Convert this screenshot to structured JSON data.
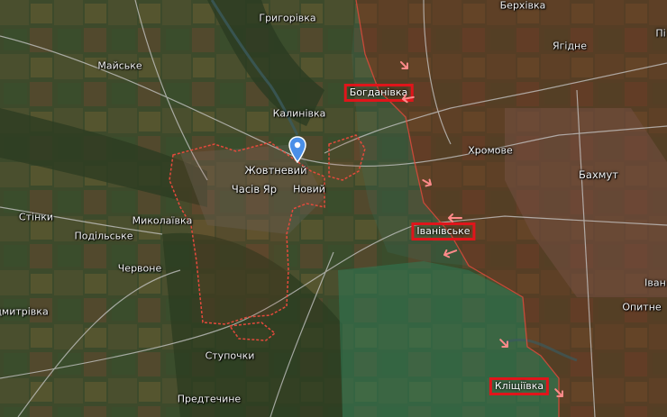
{
  "map": {
    "colors": {
      "occupied": "#7a2d1c",
      "liberated": "#2f7a55",
      "frontline": "#e54a3c",
      "highlight": "#e0151b",
      "pin": "#4a8fe8",
      "arrow": "#ff8a8a"
    },
    "labels": {
      "hryhorivka": "Григорівка",
      "berkhivka": "Берхівка",
      "maiske": "Майське",
      "yahidne": "Ягідне",
      "kalynivka": "Калинівка",
      "khromove": "Хромове",
      "zhovtnevyi": "Жовтневий",
      "bakhmut": "Бахмут",
      "chasiv_yar": "Часів Яр",
      "novyi": "Новий",
      "stinky": "Стінки",
      "mykolaivka": "Миколаївка",
      "podilske": "Подільське",
      "chervone": "Червоне",
      "opytne": "Опитне",
      "ivan_partial": "Іван",
      "dmytrivka_partial": "дмитрівка",
      "stupochky": "Ступочки",
      "predtechyne": "Предтечине",
      "pi_partial": "Пі"
    },
    "highlighted": {
      "bohdanivka": "Богданівка",
      "ivanivske": "Іванівське",
      "klishchiivka": "Кліщіївка"
    },
    "icons": {
      "pin": "location-pin-icon",
      "arrow": "attack-arrow-icon"
    }
  }
}
